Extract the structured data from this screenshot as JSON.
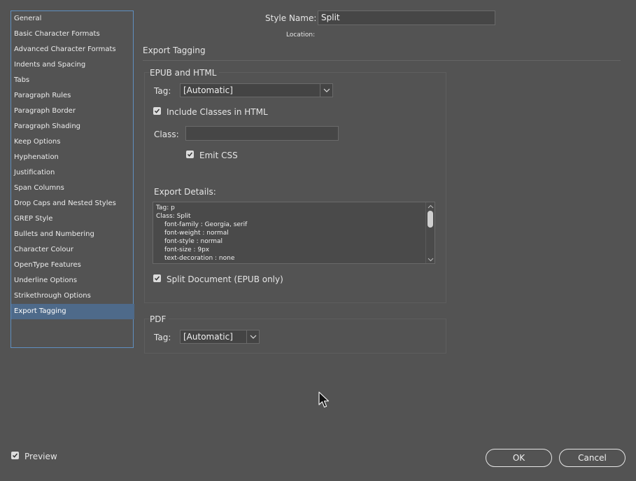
{
  "sidebar": {
    "items": [
      {
        "label": "General"
      },
      {
        "label": "Basic Character Formats"
      },
      {
        "label": "Advanced Character Formats"
      },
      {
        "label": "Indents and Spacing"
      },
      {
        "label": "Tabs"
      },
      {
        "label": "Paragraph Rules"
      },
      {
        "label": "Paragraph Border"
      },
      {
        "label": "Paragraph Shading"
      },
      {
        "label": "Keep Options"
      },
      {
        "label": "Hyphenation"
      },
      {
        "label": "Justification"
      },
      {
        "label": "Span Columns"
      },
      {
        "label": "Drop Caps and Nested Styles"
      },
      {
        "label": "GREP Style"
      },
      {
        "label": "Bullets and Numbering"
      },
      {
        "label": "Character Colour"
      },
      {
        "label": "OpenType Features"
      },
      {
        "label": "Underline Options"
      },
      {
        "label": "Strikethrough Options"
      },
      {
        "label": "Export Tagging"
      }
    ],
    "selected": "Export Tagging"
  },
  "header": {
    "style_name_label": "Style Name:",
    "style_name_value": "Split",
    "location_label": "Location:",
    "section_title": "Export Tagging"
  },
  "epub": {
    "title": "EPUB and HTML",
    "tag_label": "Tag:",
    "tag_value": "[Automatic]",
    "include_classes_label": "Include Classes in HTML",
    "include_classes_checked": true,
    "class_label": "Class:",
    "class_value": "",
    "emit_css_label": "Emit CSS",
    "emit_css_checked": true,
    "export_details_label": "Export Details:",
    "export_details_lines": [
      "Tag: p",
      "Class: Split",
      "font-family : Georgia, serif",
      "font-weight : normal",
      "font-style : normal",
      "font-size : 9px",
      "text-decoration : none"
    ],
    "split_document_label": "Split Document (EPUB only)",
    "split_document_checked": true
  },
  "pdf": {
    "title": "PDF",
    "tag_label": "Tag:",
    "tag_value": "[Automatic]"
  },
  "footer": {
    "preview_label": "Preview",
    "preview_checked": true,
    "ok_label": "OK",
    "cancel_label": "Cancel"
  },
  "colors": {
    "background": "#535353",
    "selection": "#4e6a8a",
    "focus_border": "#5f8fc0"
  }
}
